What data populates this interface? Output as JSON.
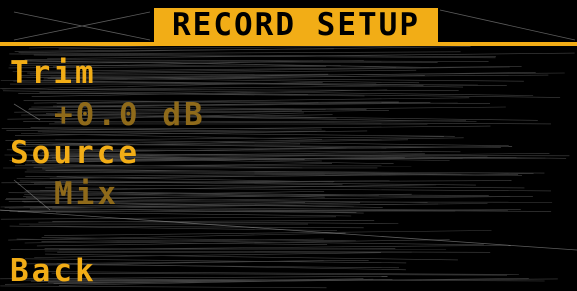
{
  "header": {
    "title": "RECORD SETUP"
  },
  "menu": {
    "items": [
      {
        "label": "Trim",
        "value": "+0.0 dB"
      },
      {
        "label": "Source",
        "value": "Mix"
      },
      {
        "label": "Back"
      }
    ]
  },
  "colors": {
    "background": "#000000",
    "accent": "#f2ad16",
    "value_text": "#8f6a1a",
    "title_text": "#000000"
  }
}
